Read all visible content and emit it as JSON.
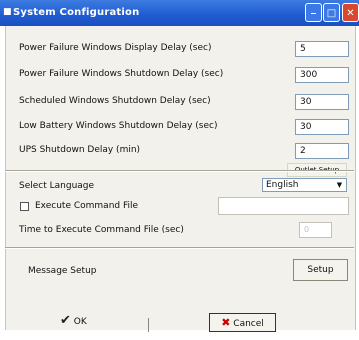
{
  "window": {
    "title": "System Configuration",
    "app_icon": "ups-icon",
    "controls": {
      "minimize": "minimize-icon",
      "maximize": "maximize-icon",
      "close": "close-icon"
    }
  },
  "fields": [
    {
      "label": "Power Failure Windows Display Delay (sec)",
      "value": "5"
    },
    {
      "label": "Power Failure Windows Shutdown Delay (sec)",
      "value": "300"
    },
    {
      "label": "Scheduled Windows Shutdown Delay (sec)",
      "value": "30"
    },
    {
      "label": "Low Battery Windows Shutdown Delay (sec)",
      "value": "30"
    },
    {
      "label": "UPS Shutdown Delay (min)",
      "value": "2"
    }
  ],
  "outlet_setup_label": "Outlet Setup",
  "language": {
    "label": "Select Language",
    "selected": "English"
  },
  "execute_command": {
    "label": "Execute Command File",
    "checked": false,
    "path": ""
  },
  "time_to_execute": {
    "label": "Time to Execute Command File (sec)",
    "value": "0"
  },
  "message_setup": {
    "label": "Message Setup",
    "button": "Setup"
  },
  "footer": {
    "ok": "OK",
    "cancel": "Cancel"
  },
  "colors": {
    "titlebar": "#1f5bd0",
    "close_button": "#d8482e",
    "dialog_bg": "#f2f1ec"
  }
}
